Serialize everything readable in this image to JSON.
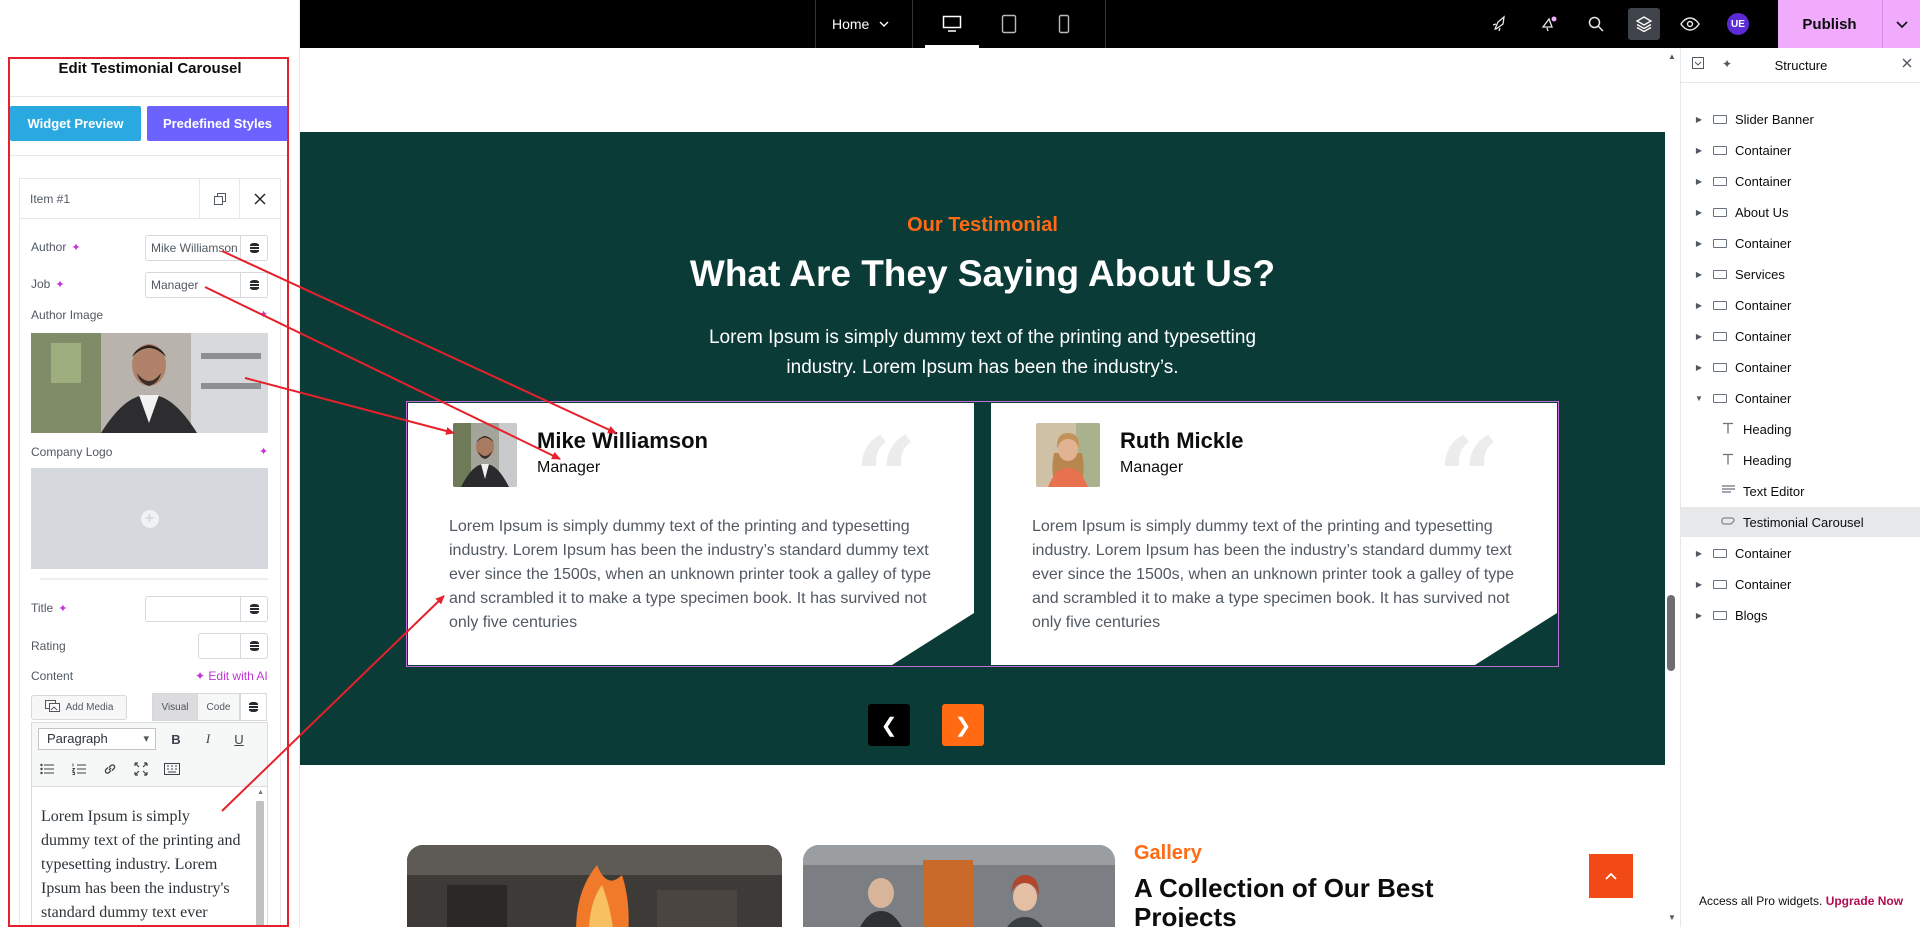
{
  "topbar": {
    "page_select": "Home",
    "publish_label": "Publish",
    "user_initials": "UE"
  },
  "panel": {
    "title": "Edit Testimonial Carousel",
    "widget_preview_label": "Widget Preview",
    "predefined_styles_label": "Predefined Styles",
    "item_title": "Item #1",
    "author_label": "Author",
    "author_value": "Mike Williamson",
    "job_label": "Job",
    "job_value": "Manager",
    "author_image_label": "Author Image",
    "company_logo_label": "Company Logo",
    "title_label": "Title",
    "title_value": "",
    "rating_label": "Rating",
    "rating_value": "",
    "content_label": "Content",
    "edit_ai_label": "Edit with AI",
    "add_media_label": "Add Media",
    "tab_visual": "Visual",
    "tab_code": "Code",
    "format_select": "Paragraph",
    "editor_text": "Lorem Ipsum is simply dummy text of the printing and typesetting industry. Lorem Ipsum has been the industry's standard dummy text ever"
  },
  "section": {
    "subtitle": "Our Testimonial",
    "heading": "What Are They Saying About Us?",
    "description": "Lorem Ipsum is simply dummy text of the printing and typesetting industry. Lorem Ipsum has been the industry’s.",
    "cards": [
      {
        "name": "Mike Williamson",
        "job": "Manager",
        "quote_glyph": "“",
        "text": "Lorem Ipsum is simply dummy text of the printing and typesetting industry. Lorem Ipsum has been the industry’s standard dummy text ever since the 1500s, when an unknown printer took a galley of type and scrambled it to make a type specimen book. It has survived not only five centuries"
      },
      {
        "name": "Ruth Mickle",
        "job": "Manager",
        "quote_glyph": "“",
        "text": "Lorem Ipsum is simply dummy text of the printing and typesetting industry. Lorem Ipsum has been the industry’s standard dummy text ever since the 1500s, when an unknown printer took a galley of type and scrambled it to make a type specimen book. It has survived not only five centuries"
      }
    ],
    "prev_glyph": "❮",
    "next_glyph": "❯",
    "accent_color": "#ff6a13",
    "section_color": "#0b3b37"
  },
  "gallery": {
    "subtitle": "Gallery",
    "heading": "A Collection of Our Best Projects"
  },
  "structure": {
    "title": "Structure",
    "items": [
      {
        "label": "Slider Banner",
        "level": 0,
        "icon": "container-icon",
        "expanded": false
      },
      {
        "label": "Container",
        "level": 0,
        "icon": "container-icon",
        "expanded": false
      },
      {
        "label": "Container",
        "level": 0,
        "icon": "container-icon",
        "expanded": false
      },
      {
        "label": "About Us",
        "level": 0,
        "icon": "container-icon",
        "expanded": false
      },
      {
        "label": "Container",
        "level": 0,
        "icon": "container-icon",
        "expanded": false
      },
      {
        "label": "Services",
        "level": 0,
        "icon": "container-icon",
        "expanded": false
      },
      {
        "label": "Container",
        "level": 0,
        "icon": "container-icon",
        "expanded": false
      },
      {
        "label": "Container",
        "level": 0,
        "icon": "container-icon",
        "expanded": false
      },
      {
        "label": "Container",
        "level": 0,
        "icon": "container-icon",
        "expanded": false
      },
      {
        "label": "Container",
        "level": 0,
        "icon": "container-icon",
        "expanded": true
      },
      {
        "label": "Heading",
        "level": 1,
        "icon": "heading-icon"
      },
      {
        "label": "Heading",
        "level": 1,
        "icon": "heading-icon"
      },
      {
        "label": "Text Editor",
        "level": 1,
        "icon": "text-editor-icon"
      },
      {
        "label": "Testimonial Carousel",
        "level": 1,
        "icon": "carousel-icon",
        "active": true
      },
      {
        "label": "Container",
        "level": 0,
        "icon": "container-icon",
        "expanded": false
      },
      {
        "label": "Container",
        "level": 0,
        "icon": "container-icon",
        "expanded": false
      },
      {
        "label": "Blogs",
        "level": 0,
        "icon": "container-icon",
        "expanded": false
      }
    ],
    "footer_text": "Access all Pro widgets.",
    "footer_link": "Upgrade Now"
  }
}
